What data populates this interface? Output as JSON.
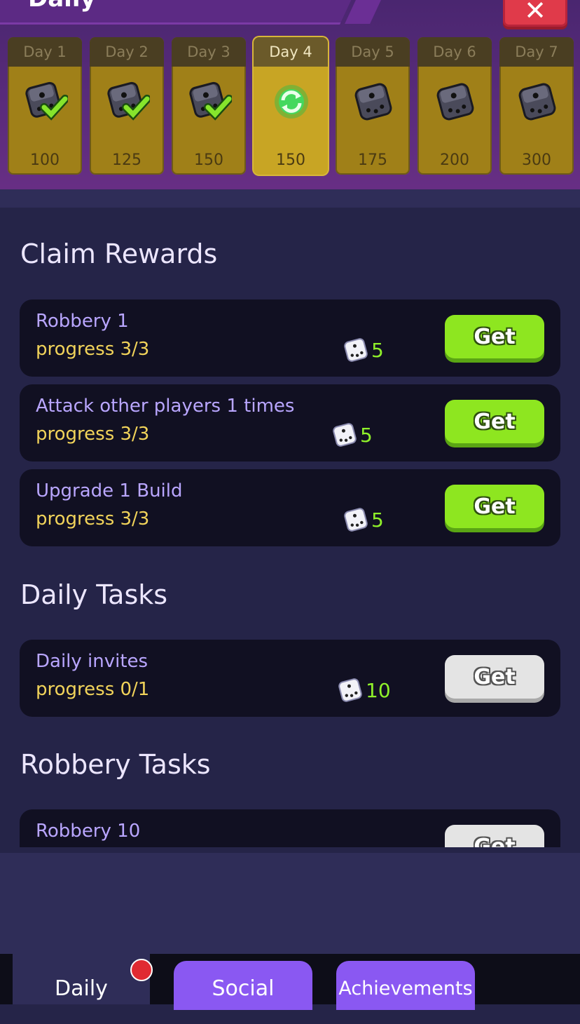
{
  "header": {
    "title": "Daily",
    "close_label": "✕"
  },
  "days": [
    {
      "label": "Day 1",
      "amount": "100",
      "state": "claimed"
    },
    {
      "label": "Day 2",
      "amount": "125",
      "state": "claimed"
    },
    {
      "label": "Day 3",
      "amount": "150",
      "state": "claimed"
    },
    {
      "label": "Day 4",
      "amount": "150",
      "state": "current"
    },
    {
      "label": "Day 5",
      "amount": "175",
      "state": "locked"
    },
    {
      "label": "Day 6",
      "amount": "200",
      "state": "locked"
    },
    {
      "label": "Day 7",
      "amount": "300",
      "state": "locked"
    }
  ],
  "claim_rewards": {
    "title": "Claim Rewards",
    "items": [
      {
        "name": "Robbery 1",
        "progress": "progress 3/3",
        "reward": "5",
        "button": "Get"
      },
      {
        "name": "Attack other players 1 times",
        "progress": "progress 3/3",
        "reward": "5",
        "button": "Get"
      },
      {
        "name": "Upgrade 1 Build",
        "progress": "progress 3/3",
        "reward": "5",
        "button": "Get"
      }
    ]
  },
  "daily_tasks": {
    "title": "Daily Tasks",
    "items": [
      {
        "name": "Daily invites",
        "progress": "progress 0/1",
        "reward": "10",
        "button": "Get"
      }
    ]
  },
  "robbery_tasks": {
    "title": "Robbery Tasks",
    "items": [
      {
        "name": "Robbery 10",
        "button": "Get"
      }
    ]
  },
  "nav": {
    "daily": "Daily",
    "social": "Social",
    "achievements": "Achievements"
  },
  "colors": {
    "accent_green": "#8ee620",
    "progress_yellow": "#f1d35a",
    "tab_purple": "#8a58f2"
  }
}
